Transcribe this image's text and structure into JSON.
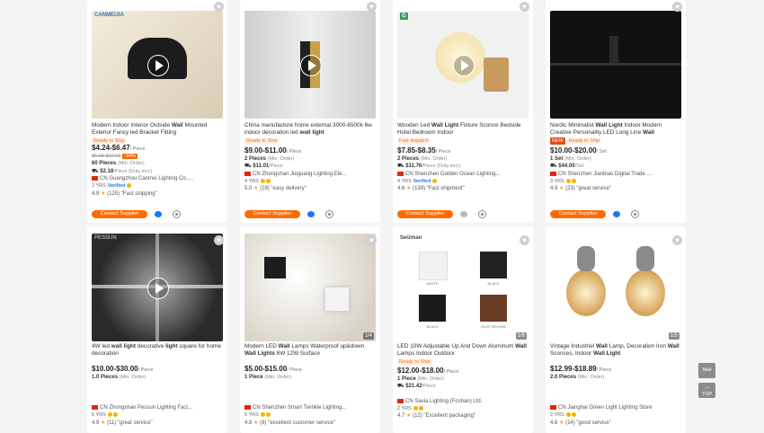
{
  "cards": [
    {
      "title_pre": "Modern Indoor Interior Outside ",
      "title_bold": "Wall",
      "title_post": " Mounted Exterior Fancy led Bracket Fitting",
      "tag": "Ready to Ship",
      "price": "$4.24-$6.47",
      "price_unit": "/ Piece",
      "orig_price": "$5.65-$12.56",
      "discount": "-34%",
      "moq_qty": "60 Pieces",
      "moq_label": "(Min. Order)",
      "ship": "$2.18",
      "ship_label": "/Piece (Duty incl.)",
      "country": "CN",
      "supplier": "Guangzhou Canmei Lighting Co.,...",
      "years": "2 YRS",
      "verified": "Verified",
      "rating": "4.9",
      "reviews": "(125)",
      "review_text": "\"Fast shipping\"",
      "brand": "CANMEIJIA",
      "button": "Contact Supplier"
    },
    {
      "title_pre": "China manufacture home external 3000-6500k 6w indoor decoration led ",
      "title_bold": "wall light",
      "title_post": "",
      "tag": "Ready to Ship",
      "price": "$9.00-$11.00",
      "price_unit": "/ Piece",
      "moq_qty": "2 Pieces",
      "moq_label": "(Min. Order)",
      "ship": "$11.01",
      "ship_label": "/Piece",
      "country": "CN",
      "supplier": "Zhongshan Jieguang Lighting Ele...",
      "years": "4 YRS",
      "rating": "5.0",
      "reviews": "(19)",
      "review_text": "\"easy delivery\"",
      "button": "Contact Supplier"
    },
    {
      "title_pre": "Wooden Led ",
      "title_bold": "Wall Light",
      "title_post": " Fixture Sconce Bedside Hotel Bedroom Indoor",
      "tag": "Fast dispatch",
      "price": "$7.85-$8.35",
      "price_unit": "/ Piece",
      "moq_qty": "2 Pieces",
      "moq_label": "(Min. Order)",
      "ship": "$11.76",
      "ship_label": "/Piece (Duty incl.)",
      "country": "CN",
      "supplier": "Shenzhen Golden Ocean Lighting...",
      "years": "4 YRS",
      "verified": "Verified",
      "rating": "4.6",
      "reviews": "(139)",
      "review_text": "\"Fast shipment\"",
      "brand": "G",
      "button": "Contact Supplier"
    },
    {
      "title_pre": "Nordic Minimalist ",
      "title_bold": "Wall Light",
      "title_post": " Indoor Modern Creative Personality LED Long Line ",
      "title_bold2": "Wall",
      "tag": "Ready to Ship",
      "tag_red": "NEW",
      "price": "$10.00-$20.00",
      "price_unit": "/ Set",
      "moq_qty": "1 Set",
      "moq_label": "(Min. Order)",
      "ship": "$44.00",
      "ship_label": "/Set",
      "country": "CN",
      "supplier": "Shenzhen Jianbiao Digital Trade ...",
      "years": "3 YRS",
      "rating": "4.9",
      "reviews": "(23)",
      "review_text": "\"great service\"",
      "button": "Contact Supplier"
    },
    {
      "title_pre": "4W led ",
      "title_bold": "wall light",
      "title_post": " decorative ",
      "title_bold2": "light",
      "title_post2": " square for home decoration",
      "price": "$10.00-$30.00",
      "price_unit": "/ Piece",
      "moq_qty": "1.0 Pieces",
      "moq_label": "(Min. Order)",
      "country": "CN",
      "supplier": "Zhongshan Pessun Lighting Fact...",
      "years": "6 YRS",
      "rating": "4.9",
      "reviews": "(11)",
      "review_text": "\"great service\"",
      "brand": "PESSUN",
      "button": "Contact Supplier"
    },
    {
      "title_pre": "Modern LED ",
      "title_bold": "Wall",
      "title_post": " Lamps Waterproof up&down ",
      "title_bold2": "Wall Lights",
      "title_post2": " 6W 12W Surface",
      "price": "$5.00-$15.00",
      "price_unit": "/ Piece",
      "moq_qty": "1 Piece",
      "moq_label": "(Min. Order)",
      "country": "CN",
      "supplier": "Shenzhen Smart Twinkle Lighting...",
      "years": "5 YRS",
      "rating": "4.8",
      "reviews": "(8)",
      "review_text": "\"excellent customer service\"",
      "counter": "1/4",
      "button": "Contact Supplier"
    },
    {
      "title_pre": "LED 10W Adjustable Up And Down Aluminum ",
      "title_bold": "Wall",
      "title_post": " Lamps Indoor Outdoor",
      "tag": "Ready to Ship",
      "price": "$12.00-$18.00",
      "price_unit": "/ Piece",
      "moq_qty": "1 Piece",
      "moq_label": "(Min. Order)",
      "ship": "$21.42",
      "ship_label": "/Piece",
      "country": "CN",
      "supplier": "Savia Lighting (Foshan) Ltd.",
      "years": "2 YRS",
      "rating": "4.7",
      "reviews": "(12)",
      "review_text": "\"Excellent packaging\"",
      "brand": "Seizman",
      "counter": "1/6",
      "swatches": [
        "WHITE",
        "BLACK",
        "BLACK",
        "RUST BROWN"
      ],
      "button": "Contact Supplier"
    },
    {
      "title_pre": "Vintage Industriel ",
      "title_bold": "Wall",
      "title_post": " Lamp, Decoration Iron ",
      "title_bold2": "Wall",
      "title_post2": " Sconces, Indoor ",
      "title_bold3": "Wall Light",
      "price": "$12.99-$18.89",
      "price_unit": "/ Piece",
      "moq_qty": "2.0 Pieces",
      "moq_label": "(Min. Order)",
      "country": "CN",
      "supplier": "Jianghai Green Light Lighting Store",
      "years": "2 YRS",
      "rating": "4.6",
      "reviews": "(14)",
      "review_text": "\"good service\"",
      "counter": "1/5",
      "button": "Contact Supplier"
    }
  ],
  "side": {
    "feedback": "Mail",
    "top": "TOP"
  },
  "colors": {
    "accent": "#ff6a00",
    "verified": "#1677ff",
    "star": "#f5a623"
  }
}
